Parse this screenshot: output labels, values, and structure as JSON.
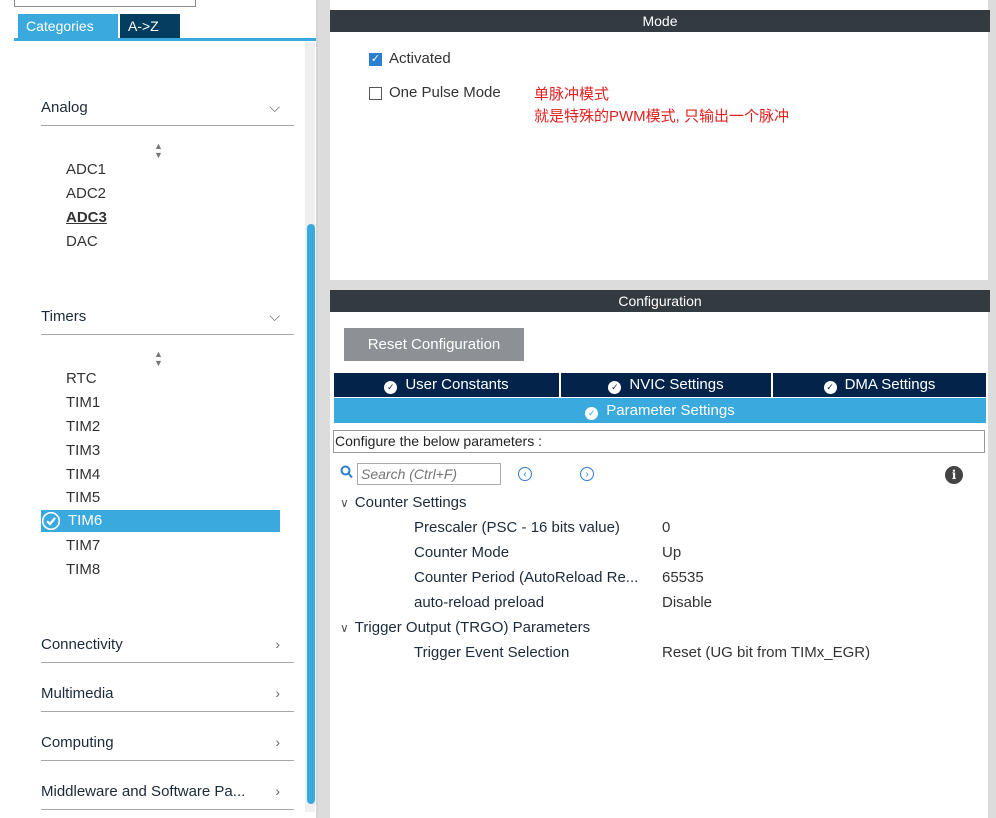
{
  "left_panel": {
    "tabs": [
      "Categories",
      "A->Z"
    ],
    "groups": [
      {
        "label": "Analog",
        "items": [
          "ADC1",
          "ADC2",
          "ADC3",
          "DAC"
        ],
        "bold_item": "ADC3"
      },
      {
        "label": "Timers",
        "items": [
          "RTC",
          "TIM1",
          "TIM2",
          "TIM3",
          "TIM4",
          "TIM5",
          "TIM6",
          "TIM7",
          "TIM8"
        ],
        "selected_item": "TIM6"
      }
    ],
    "collapsed_groups": [
      "Connectivity",
      "Multimedia",
      "Computing",
      "Middleware and Software Pa..."
    ]
  },
  "mode": {
    "title": "Mode",
    "activated_label": "Activated",
    "activated_checked": true,
    "one_pulse_label": "One Pulse Mode",
    "one_pulse_checked": false,
    "note_line1": "单脉冲模式",
    "note_line2": "就是特殊的PWM模式, 只输出一个脉冲"
  },
  "configuration": {
    "title": "Configuration",
    "reset_button": "Reset Configuration",
    "tabs": [
      "User Constants",
      "NVIC Settings",
      "DMA Settings"
    ],
    "active_tab": "Parameter Settings",
    "description": "Configure the below parameters :",
    "search_placeholder": "Search (Ctrl+F)",
    "sections": [
      {
        "title": "Counter Settings",
        "params": [
          {
            "name": "Prescaler (PSC - 16 bits value)",
            "value": "0"
          },
          {
            "name": "Counter Mode",
            "value": "Up"
          },
          {
            "name": "Counter Period (AutoReload Re...",
            "value": "65535"
          },
          {
            "name": "auto-reload preload",
            "value": "Disable"
          }
        ]
      },
      {
        "title": "Trigger Output (TRGO) Parameters",
        "params": [
          {
            "name": "Trigger Event Selection",
            "value": "Reset (UG bit from TIMx_EGR)"
          }
        ]
      }
    ]
  },
  "colors": {
    "accent": "#3aa9de",
    "tab_dark": "#03234b",
    "header": "#333a40",
    "note": "#e02020"
  }
}
